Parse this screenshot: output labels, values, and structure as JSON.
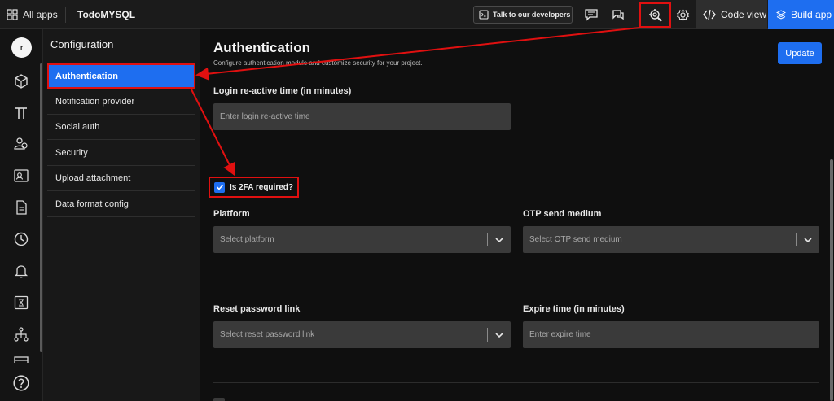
{
  "topbar": {
    "all_apps": "All apps",
    "app_name": "TodoMYSQL",
    "talk_to_devs": "Talk to our developers",
    "code_view": "Code view",
    "build_app": "Build app"
  },
  "rail": {
    "avatar_letter": "r",
    "icons": [
      "cube-icon",
      "pi-icon",
      "users-icon",
      "profile-card-icon",
      "document-icon",
      "clock-icon",
      "bell-icon",
      "function-icon",
      "hierarchy-icon",
      "table-icon",
      "help-icon"
    ]
  },
  "config": {
    "title": "Configuration",
    "items": [
      {
        "label": "Authentication"
      },
      {
        "label": "Notification provider"
      },
      {
        "label": "Social auth"
      },
      {
        "label": "Security"
      },
      {
        "label": "Upload attachment"
      },
      {
        "label": "Data format config"
      }
    ]
  },
  "main": {
    "title": "Authentication",
    "subtitle": "Configure authentication module and customize security for your project.",
    "update_label": "Update",
    "login_reactive": {
      "label": "Login re-active time (in minutes)",
      "placeholder": "Enter login re-active time"
    },
    "two_fa": {
      "label": "Is 2FA required?",
      "checked": true
    },
    "platform": {
      "label": "Platform",
      "placeholder": "Select platform"
    },
    "otp_medium": {
      "label": "OTP send medium",
      "placeholder": "Select OTP send medium"
    },
    "reset_link": {
      "label": "Reset password link",
      "placeholder": "Select reset password link"
    },
    "expire_time": {
      "label": "Expire time (in minutes)",
      "placeholder": "Enter expire time"
    }
  },
  "colors": {
    "accent": "#1e6ef0",
    "highlight": "#e01010",
    "background": "#0f0f0f",
    "field": "#3a3a3a"
  }
}
